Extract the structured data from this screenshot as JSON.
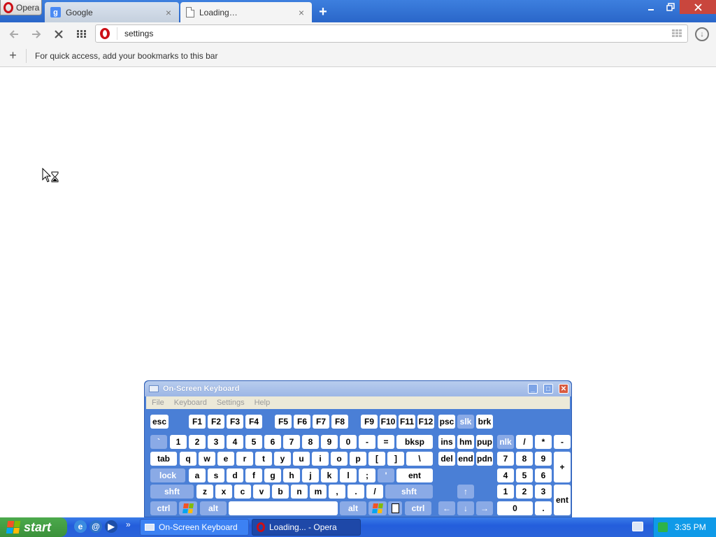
{
  "browser": {
    "menu_label": "Opera",
    "tabs": [
      {
        "title": "Google",
        "close": "×"
      },
      {
        "title": "Loading…",
        "close": "×"
      }
    ],
    "new_tab": "+",
    "address": "settings",
    "bookmarks_hint": "For quick access, add your bookmarks to this bar",
    "bookmarks_add": "+"
  },
  "osk": {
    "title": "On-Screen Keyboard",
    "menu": [
      "File",
      "Keyboard",
      "Settings",
      "Help"
    ],
    "keys": {
      "esc": "esc",
      "f1": "F1",
      "f2": "F2",
      "f3": "F3",
      "f4": "F4",
      "f5": "F5",
      "f6": "F6",
      "f7": "F7",
      "f8": "F8",
      "f9": "F9",
      "f10": "F10",
      "f11": "F11",
      "f12": "F12",
      "psc": "psc",
      "slk": "slk",
      "brk": "brk",
      "backtick": "`",
      "n1": "1",
      "n2": "2",
      "n3": "3",
      "n4": "4",
      "n5": "5",
      "n6": "6",
      "n7": "7",
      "n8": "8",
      "n9": "9",
      "n0": "0",
      "minus": "-",
      "equals": "=",
      "bksp": "bksp",
      "ins": "ins",
      "hm": "hm",
      "pup": "pup",
      "nlk": "nlk",
      "np_div": "/",
      "np_mul": "*",
      "np_sub": "-",
      "tab": "tab",
      "q": "q",
      "w": "w",
      "e": "e",
      "r": "r",
      "t": "t",
      "y": "y",
      "u": "u",
      "i": "i",
      "o": "o",
      "p": "p",
      "lbr": "[",
      "rbr": "]",
      "bslash": "\\",
      "del": "del",
      "end": "end",
      "pdn": "pdn",
      "np7": "7",
      "np8": "8",
      "np9": "9",
      "np_add": "+",
      "lock": "lock",
      "a": "a",
      "s": "s",
      "d": "d",
      "f": "f",
      "g": "g",
      "h": "h",
      "j": "j",
      "k": "k",
      "l": "l",
      "semi": ";",
      "quote": "'",
      "ent": "ent",
      "np4": "4",
      "np5": "5",
      "np6": "6",
      "lshft": "shft",
      "z": "z",
      "x": "x",
      "c": "c",
      "v": "v",
      "b": "b",
      "n": "n",
      "m": "m",
      "comma": ",",
      "period": ".",
      "slash": "/",
      "rshft": "shft",
      "up": "↑",
      "np1": "1",
      "np2": "2",
      "np3": "3",
      "np_ent": "ent",
      "lctrl": "ctrl",
      "lalt": "alt",
      "space": "",
      "ralt": "alt",
      "rctrl": "ctrl",
      "left": "←",
      "down": "↓",
      "right": "→",
      "np0": "0",
      "np_dot": "."
    }
  },
  "taskbar": {
    "start": "start",
    "expand": "»",
    "items": [
      {
        "title": "On-Screen Keyboard"
      },
      {
        "title": "Loading... - Opera"
      }
    ],
    "clock": "3:35 PM"
  }
}
